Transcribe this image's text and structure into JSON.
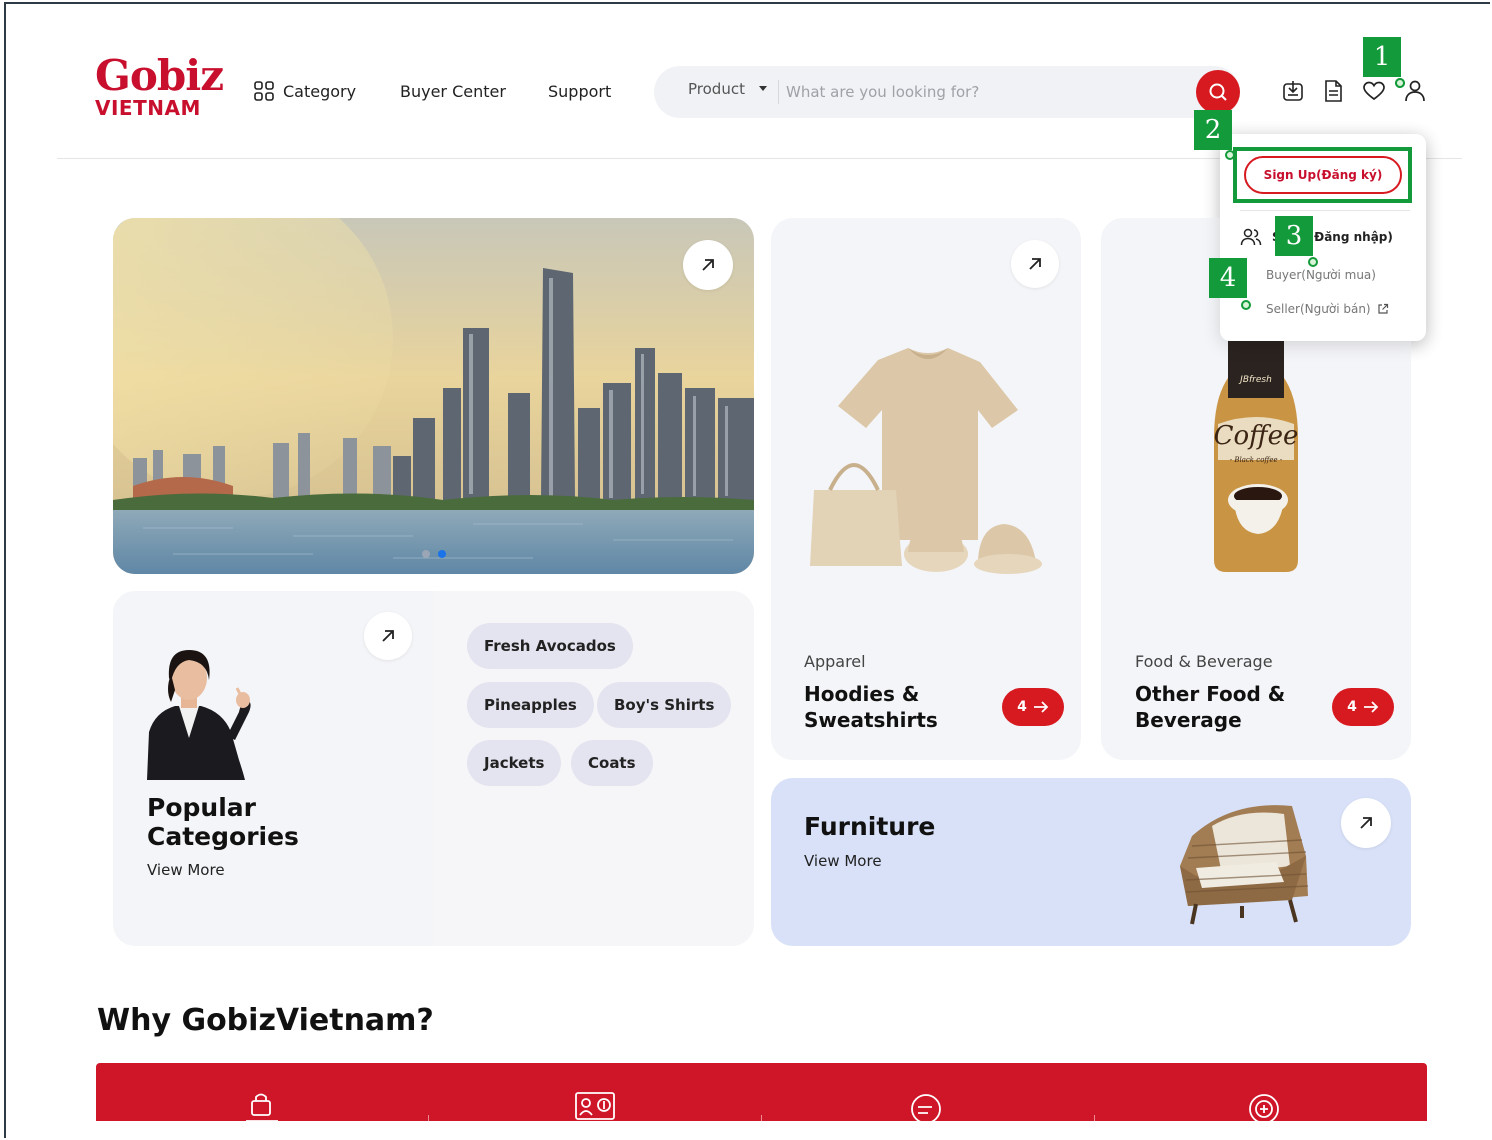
{
  "header": {
    "logo_main": "Gobiz",
    "logo_sub": "VIETNAM",
    "nav": {
      "category": "Category",
      "buyer_center": "Buyer Center",
      "support": "Support"
    },
    "search": {
      "selected_type": "Product",
      "placeholder": "What are you looking for?"
    }
  },
  "dropdown": {
    "signup": "Sign Up(Đăng ký)",
    "signin_prefix": "S",
    "signin_suffix": "(Đăng nhập)",
    "buyer": "Buyer(Người mua)",
    "seller": "Seller(Người bán)"
  },
  "annotations": [
    "1",
    "2",
    "3",
    "4"
  ],
  "popular": {
    "title_line1": "Popular",
    "title_line2": "Categories",
    "view_more": "View More",
    "chips": [
      "Fresh Avocados",
      "Pineapples",
      "Boy's Shirts",
      "Jackets",
      "Coats"
    ]
  },
  "cards": {
    "apparel": {
      "label": "Apparel",
      "title_line1": "Hoodies &",
      "title_line2": "Sweatshirts",
      "count": "4"
    },
    "food": {
      "label": "Food & Beverage",
      "title_line1": "Other Food &",
      "title_line2": "Beverage",
      "count": "4",
      "bottle_brand": "JBfresh",
      "bottle_text": "Coffee",
      "bottle_sub": "- Black coffee -"
    },
    "furniture": {
      "title": "Furniture",
      "view_more": "View More"
    }
  },
  "why": {
    "title": "Why GobizVietnam?"
  },
  "colors": {
    "brand_red": "#d71920",
    "marker_green": "#139a3a",
    "chip_bg": "#e4e4f0",
    "furniture_bg": "#d8e1f8",
    "carousel_active": "#1a73e8"
  },
  "carousel": {
    "slides": 2,
    "active": 2
  }
}
